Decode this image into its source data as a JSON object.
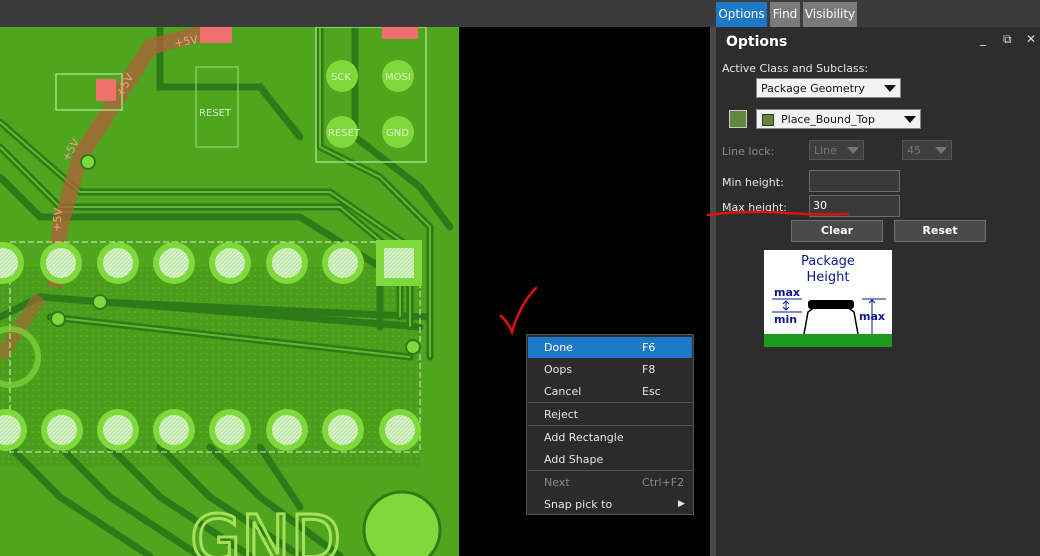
{
  "tabs": [
    {
      "label": "Options",
      "active": true
    },
    {
      "label": "Find",
      "active": false
    },
    {
      "label": "Visibility",
      "active": false
    }
  ],
  "pcb": {
    "labels": [
      "+5V",
      "+5V",
      "+5V",
      "+5V",
      "SCK",
      "MOSI",
      "RESET",
      "GND",
      "RESET",
      "GND"
    ]
  },
  "options": {
    "title": "Options",
    "window_controls": {
      "minimize": "_",
      "restore": "⧉",
      "close": "✕"
    },
    "active_class_label": "Active Class and Subclass:",
    "class_value": "Package Geometry",
    "subclass_value": "Place_Bound_Top",
    "subclass_color": "#5e8a3a",
    "line_lock_label": "Line lock:",
    "line_lock_value": "Line",
    "line_lock_angle": "45",
    "min_height_label": "Min height:",
    "min_height_value": "",
    "max_height_label": "Max height:",
    "max_height_value": "30",
    "clear_label": "Clear",
    "reset_label": "Reset",
    "package_diagram": {
      "title_line1": "Package",
      "title_line2": "Height",
      "max_label": "max",
      "min_label": "min",
      "max_right_label": "max"
    }
  },
  "context_menu": {
    "items": [
      {
        "label": "Done",
        "shortcut": "F6",
        "selected": true,
        "disabled": false
      },
      {
        "label": "Oops",
        "shortcut": "F8",
        "selected": false,
        "disabled": false
      },
      {
        "label": "Cancel",
        "shortcut": "Esc",
        "selected": false,
        "disabled": false
      },
      {
        "label": "Reject",
        "shortcut": "",
        "selected": false,
        "disabled": false
      },
      {
        "label": "Add Rectangle",
        "shortcut": "",
        "selected": false,
        "disabled": false
      },
      {
        "label": "Add Shape",
        "shortcut": "",
        "selected": false,
        "disabled": false
      },
      {
        "label": "Next",
        "shortcut": "Ctrl+F2",
        "selected": false,
        "disabled": true
      },
      {
        "label": "Snap pick to",
        "shortcut": "",
        "selected": false,
        "disabled": false,
        "submenu": true
      }
    ]
  },
  "colors": {
    "accent": "#1e78c8",
    "annotation": "#e01010",
    "board": "#4fa51e",
    "trace": "#2e7a18",
    "pad": "#7fd93a"
  }
}
